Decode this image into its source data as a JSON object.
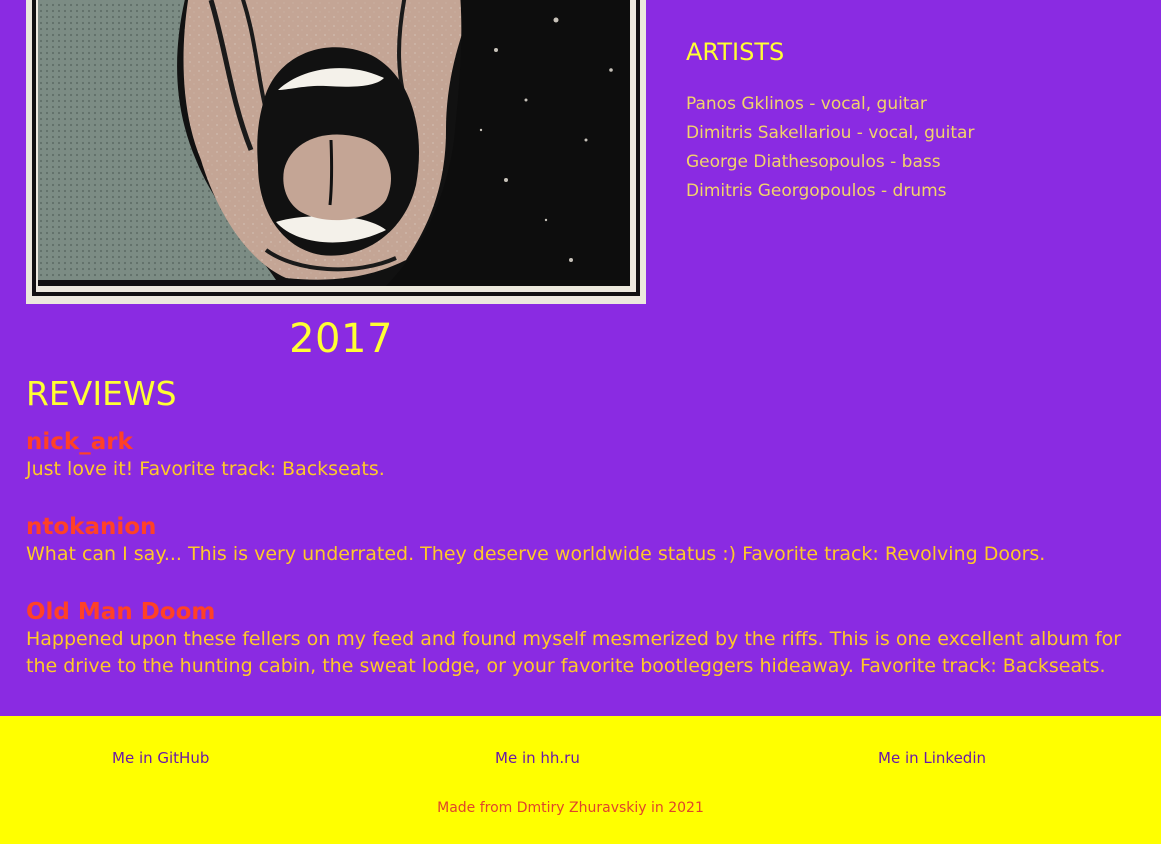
{
  "album": {
    "year": "2017"
  },
  "artists": {
    "title": "ARTISTS",
    "members": [
      "Panos Gklinos - vocal, guitar",
      "Dimitris Sakellariou - vocal, guitar",
      "George Diathesopoulos - bass",
      "Dimitris Georgopoulos - drums"
    ]
  },
  "reviews": {
    "title": "REVIEWS",
    "items": [
      {
        "author": "nick_ark",
        "text": "Just love it! Favorite track: Backseats."
      },
      {
        "author": "ntokanion",
        "text": "What can I say... This is very underrated. They deserve worldwide status :) Favorite track: Revolving Doors."
      },
      {
        "author": "Old Man Doom",
        "text": "Happened upon these fellers on my feed and found myself mesmerized by the riffs. This is one excellent album for the drive to the hunting cabin, the sweat lodge, or your favorite bootleggers hideaway. Favorite track: Backseats."
      }
    ]
  },
  "footer": {
    "links": [
      "Me in GitHub",
      "Me in hh.ru",
      "Me in Linkedin"
    ],
    "credits": "Made from Dmtiry Zhuravskiy in 2021"
  },
  "colors": {
    "background": "#8a2be2",
    "heading": "#ffff33",
    "artist_text": "#f2d46a",
    "reviewer": "#ff4127",
    "review_text": "#ffc928",
    "footer_background": "#ffff00",
    "footer_link": "#6a1aa8",
    "footer_credits": "#e0452b"
  }
}
